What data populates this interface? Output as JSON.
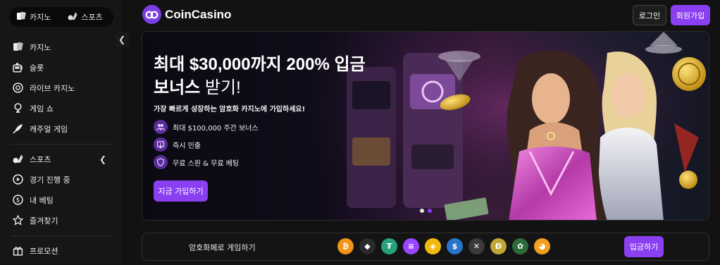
{
  "top_switch": {
    "casino": "카지노",
    "sports": "스포츠"
  },
  "sidebar": {
    "items": [
      {
        "label": "카지노",
        "icon": "cards-icon"
      },
      {
        "label": "슬롯",
        "icon": "slot-machine-icon"
      },
      {
        "label": "라이브 카지노",
        "icon": "roulette-icon"
      },
      {
        "label": "게임 쇼",
        "icon": "game-show-icon"
      },
      {
        "label": "캐주얼 게임",
        "icon": "rocket-icon"
      }
    ],
    "sports_section": {
      "label": "스포츠",
      "icon": "sports-icon"
    },
    "sports_items": [
      {
        "label": "경기 진행 중",
        "icon": "play-icon"
      },
      {
        "label": "내 베팅",
        "icon": "bet-coin-icon"
      },
      {
        "label": "즐겨찾기",
        "icon": "star-icon"
      }
    ],
    "bottom_item": {
      "label": "프로모션",
      "icon": "gift-icon"
    }
  },
  "header": {
    "logo_text": "CoinCasino",
    "login": "로그인",
    "signup": "회원가입"
  },
  "hero": {
    "title_line1": "최대 $30,000까지 200% 입금",
    "title_bold2": "보너스",
    "title_light2": " 받기!",
    "subtitle": "가장 빠르게 성장하는 암호화 카지노에 가입하세요!",
    "features": [
      {
        "text": "최대 $100,000 주간 보너스",
        "icon": "users-icon"
      },
      {
        "text": "즉시 인출",
        "icon": "withdraw-icon"
      },
      {
        "text": "무료 스핀 & 무료 베팅",
        "icon": "shield-icon"
      }
    ],
    "cta": "지금 가입하기"
  },
  "crypto_bar": {
    "label": "암호화폐로 게임하기",
    "deposit": "입금하기",
    "coins": [
      {
        "name": "bitcoin-icon",
        "color": "#f2931a",
        "glyph": "₿"
      },
      {
        "name": "ethereum-icon",
        "color": "#2a2a2a",
        "glyph": "◆"
      },
      {
        "name": "tether-icon",
        "color": "#26a17b",
        "glyph": "₮"
      },
      {
        "name": "solana-icon",
        "color": "#9945ff",
        "glyph": "≡"
      },
      {
        "name": "bnb-icon",
        "color": "#f0b90b",
        "glyph": "◈"
      },
      {
        "name": "usdc-icon",
        "color": "#2775ca",
        "glyph": "$"
      },
      {
        "name": "xrp-icon",
        "color": "#3a3a3a",
        "glyph": "✕"
      },
      {
        "name": "dogecoin-icon",
        "color": "#c2a633",
        "glyph": "Ð"
      },
      {
        "name": "rose-coin-icon",
        "color": "#2e6b3a",
        "glyph": "✿"
      },
      {
        "name": "shiba-icon",
        "color": "#f0a020",
        "glyph": "◕"
      }
    ]
  },
  "colors": {
    "accent": "#8a3ff0",
    "background": "#121212",
    "sidebar": "#161616"
  }
}
